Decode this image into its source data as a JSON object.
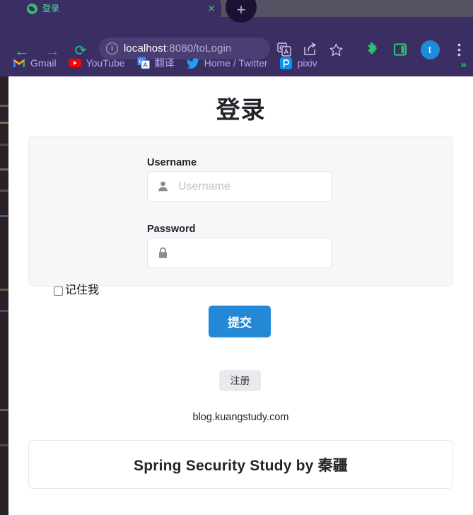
{
  "browser": {
    "tab": {
      "title": "登录",
      "favicon": "green-circle-favicon",
      "close_label": "✕"
    },
    "new_tab_label": "+",
    "nav": {
      "back_label": "←",
      "forward_label": "→",
      "reload_label": "⟳"
    },
    "omnibox": {
      "info_label": "i",
      "url_host": "localhost",
      "url_rest": ":8080/toLogin"
    },
    "toolbar_icons": [
      {
        "name": "translate-icon"
      },
      {
        "name": "share-icon"
      },
      {
        "name": "bookmark-star-icon"
      },
      {
        "name": "extensions-puzzle-icon"
      },
      {
        "name": "side-panel-icon"
      },
      {
        "name": "profile-avatar",
        "label": "t"
      },
      {
        "name": "chrome-menu-icon"
      }
    ],
    "bookmarks": [
      {
        "label": "Gmail",
        "icon": "gmail-icon"
      },
      {
        "label": "YouTube",
        "icon": "youtube-icon"
      },
      {
        "label": "翻译",
        "icon": "google-translate-icon"
      },
      {
        "label": "Home / Twitter",
        "icon": "twitter-icon"
      },
      {
        "label": "pixiv",
        "icon": "pixiv-icon"
      }
    ],
    "bookmarks_overflow_label": "»",
    "colors": {
      "chrome_bg": "#3a2e63",
      "omnibox_bg": "#4a3e73",
      "accent_green": "#2fbf71",
      "bookmark_text": "#b9a5f0"
    }
  },
  "page": {
    "title": "登录",
    "form": {
      "username_label": "Username",
      "username_value": "",
      "username_placeholder": "Username",
      "username_icon": "person-icon",
      "password_label": "Password",
      "password_value": "",
      "password_placeholder": "",
      "password_icon": "lock-icon",
      "remember_label": "记住我",
      "remember_checked": false,
      "submit_label": "提交"
    },
    "register_label": "注册",
    "blog_link": "blog.kuangstudy.com",
    "footer_text": "Spring Security Study by 秦疆",
    "colors": {
      "submit_bg": "#2388d6",
      "register_bg": "#e9eaec",
      "card_bg": "#f6f7f8"
    }
  }
}
